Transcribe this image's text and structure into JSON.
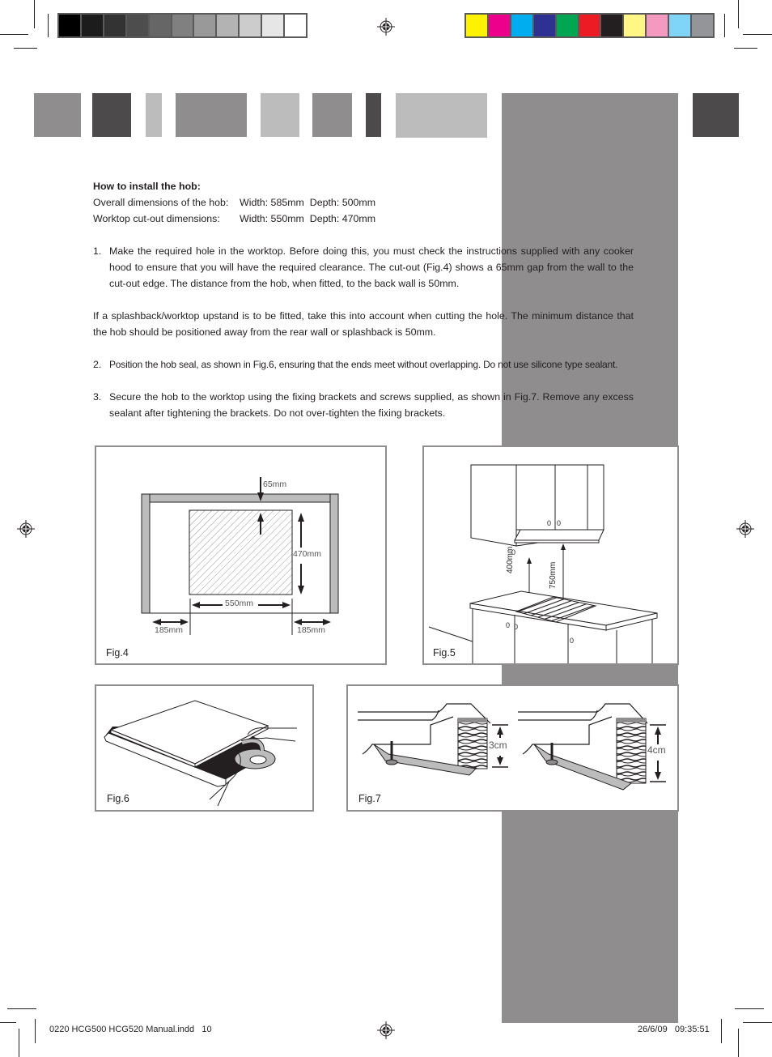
{
  "print_marks": {
    "grayscale_swatches": [
      "#000000",
      "#1c1c1c",
      "#333333",
      "#4d4d4d",
      "#666666",
      "#808080",
      "#999999",
      "#b3b3b3",
      "#cccccc",
      "#e6e6e6",
      "#ffffff"
    ],
    "color_swatches": [
      "#fff200",
      "#ec008c",
      "#00aeef",
      "#2e3192",
      "#00a651",
      "#ed1c24",
      "#231f20",
      "#fff685",
      "#f49ac1",
      "#7fd5f7",
      "#939598"
    ]
  },
  "header_tabs_colors": {
    "light": "#bcbcbc",
    "mid": "#8f8d8e",
    "dark": "#4d4a4b"
  },
  "content": {
    "heading": "How to install the hob:",
    "specs": [
      {
        "label": "Overall dimensions of the hob:",
        "value": "Width: 585mm  Depth: 500mm"
      },
      {
        "label": "Worktop cut-out dimensions:",
        "value": "Width: 550mm  Depth: 470mm"
      }
    ],
    "step1": {
      "num": "1.",
      "text": "Make the required hole in the worktop. Before doing this, you must check the instructions supplied with any cooker hood to ensure that you will have the required clearance. The cut-out (Fig.4) shows a 65mm gap from the wall to the cut-out edge. The distance from the hob, when fitted, to the back wall is 50mm."
    },
    "note": "If a splashback/worktop upstand is to be fitted, take this into account when cutting the hole. The minimum distance that the hob should be positioned away from the rear wall or splashback is 50mm.",
    "step2": {
      "num": "2.",
      "text": "Position the hob seal, as shown in Fig.6, ensuring that the ends meet without overlapping. Do not use silicone type sealant."
    },
    "step3": {
      "num": "3.",
      "text": "Secure the hob to the worktop using the fixing brackets and screws supplied, as shown in Fig.7. Remove any excess sealant after tightening the brackets. Do not over-tighten the fixing brackets."
    }
  },
  "figures": {
    "fig4": {
      "label": "Fig.4",
      "dim_top": "65mm",
      "dim_height": "470mm",
      "dim_width": "550mm",
      "dim_left": "185mm",
      "dim_right": "185mm"
    },
    "fig5": {
      "label": "Fig.5",
      "dim_cabinet": "400mm",
      "dim_hood": "750mm"
    },
    "fig6": {
      "label": "Fig.6"
    },
    "fig7": {
      "label": "Fig.7",
      "dim_left": "3cm",
      "dim_right": "4cm"
    }
  },
  "footer": {
    "file": "0220 HCG500 HCG520 Manual.indd   10",
    "timestamp": "26/6/09   09:35:51"
  }
}
